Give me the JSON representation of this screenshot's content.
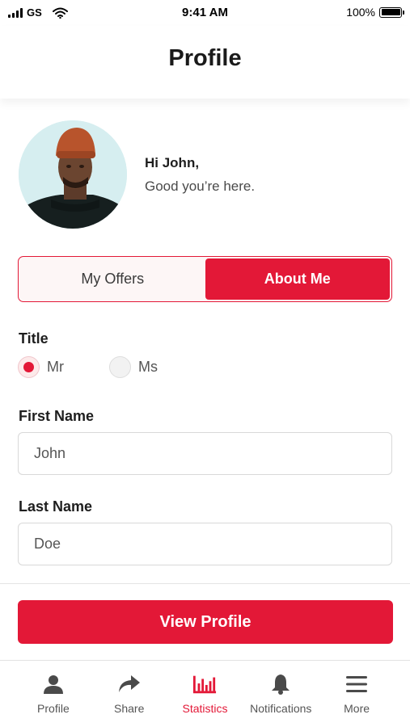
{
  "status_bar": {
    "carrier": "GS",
    "time": "9:41 AM",
    "battery": "100%"
  },
  "header": {
    "title": "Profile"
  },
  "greeting": {
    "hi": "Hi John,",
    "message": "Good you’re here."
  },
  "segmented": {
    "options": [
      "My Offers",
      "About Me"
    ],
    "selected": "About Me"
  },
  "form": {
    "title_label": "Title",
    "title_options": [
      "Mr",
      "Ms"
    ],
    "title_selected": "Mr",
    "first_name_label": "First Name",
    "first_name_value": "John",
    "last_name_label": "Last Name",
    "last_name_value": "Doe"
  },
  "actions": {
    "view_profile": "View Profile"
  },
  "tabbar": {
    "items": [
      {
        "label": "Profile",
        "icon": "person-icon"
      },
      {
        "label": "Share",
        "icon": "share-arrow-icon"
      },
      {
        "label": "Statistics",
        "icon": "bar-chart-icon"
      },
      {
        "label": "Notifications",
        "icon": "bell-icon"
      },
      {
        "label": "More",
        "icon": "menu-icon"
      }
    ],
    "active": "Statistics"
  },
  "colors": {
    "accent": "#e31837",
    "text": "#1e1e1e",
    "muted": "#555555",
    "icon": "#4a4a4a"
  }
}
